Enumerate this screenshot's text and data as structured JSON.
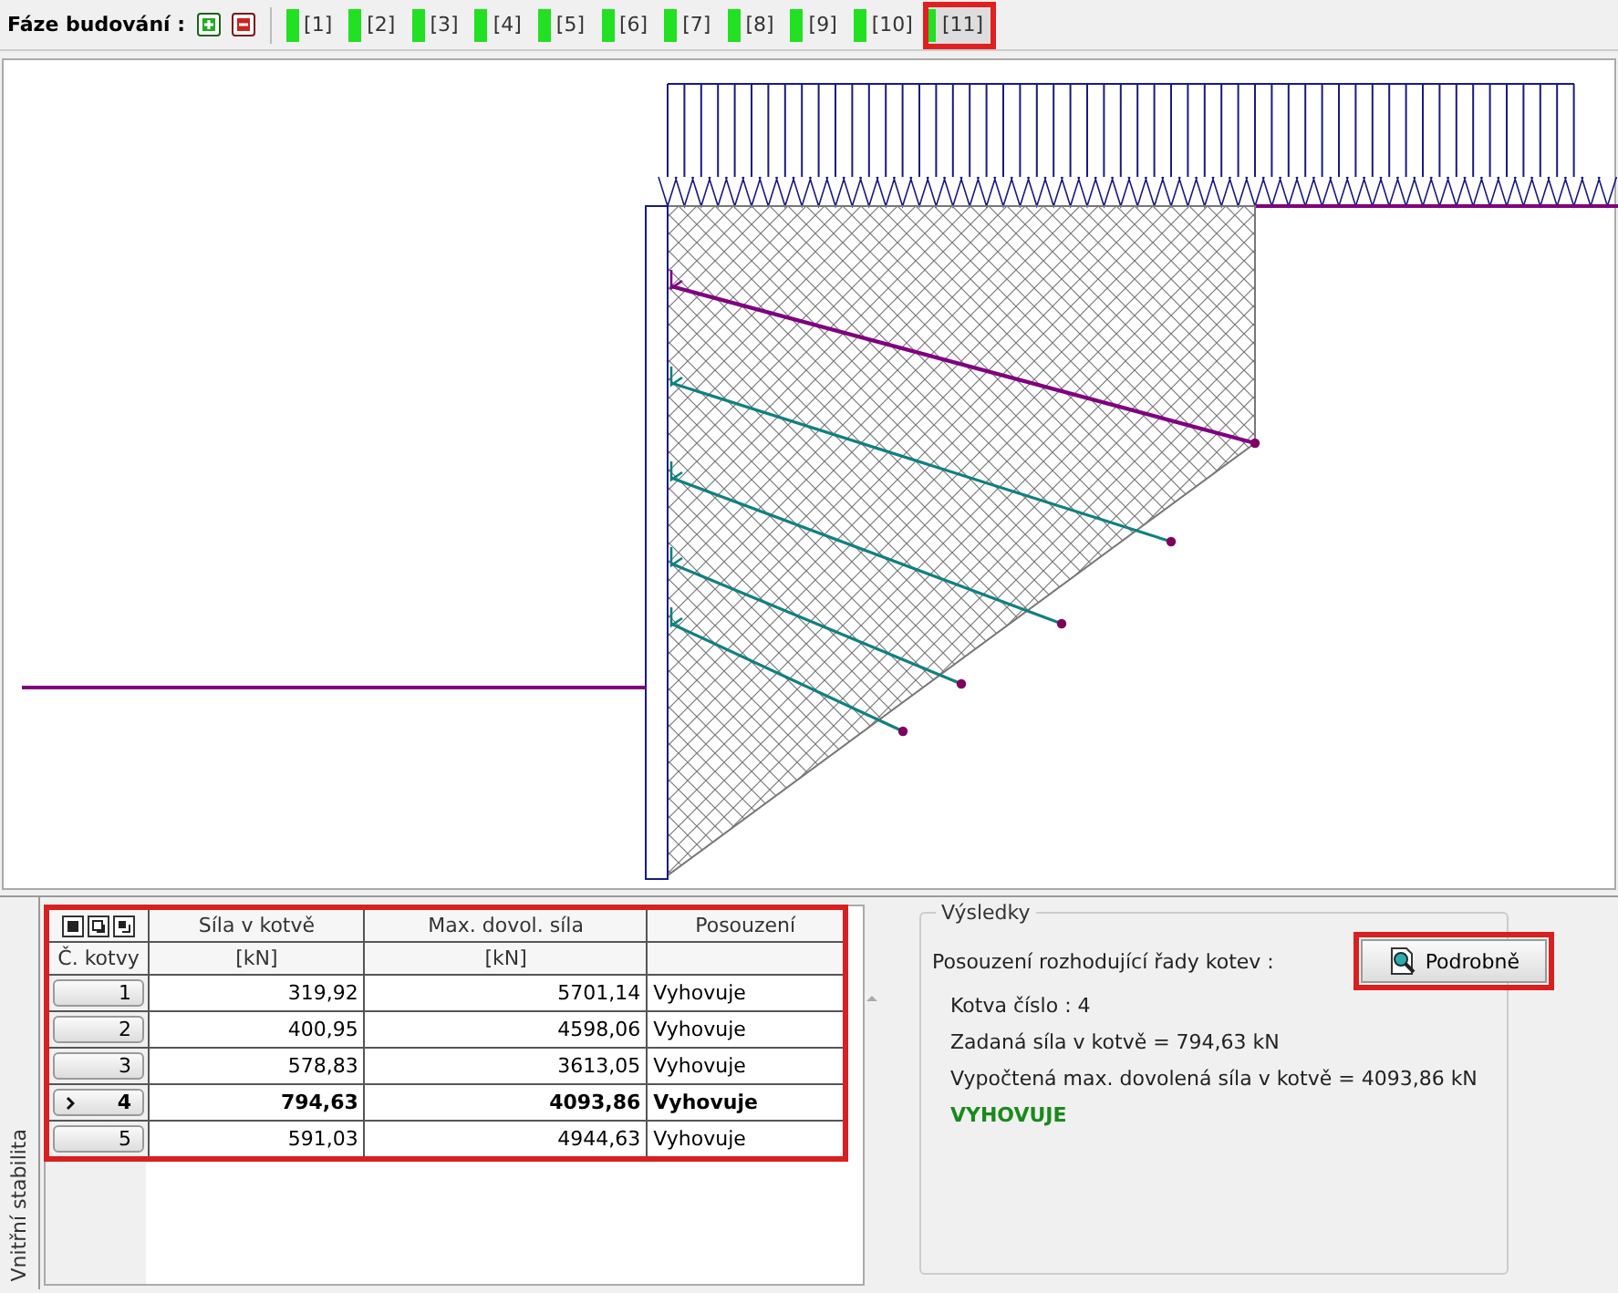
{
  "toolbar": {
    "label": "Fáze budování :",
    "phases": [
      {
        "label": "[1]",
        "selected": false
      },
      {
        "label": "[2]",
        "selected": false
      },
      {
        "label": "[3]",
        "selected": false
      },
      {
        "label": "[4]",
        "selected": false
      },
      {
        "label": "[5]",
        "selected": false
      },
      {
        "label": "[6]",
        "selected": false
      },
      {
        "label": "[7]",
        "selected": false
      },
      {
        "label": "[8]",
        "selected": false
      },
      {
        "label": "[9]",
        "selected": false
      },
      {
        "label": "[10]",
        "selected": false
      },
      {
        "label": "[11]",
        "selected": true
      }
    ]
  },
  "side_tab": "Vnitřní stabilita",
  "table": {
    "columns": [
      {
        "title": "Č. kotvy"
      },
      {
        "title": "Síla v kotvě",
        "unit": "[kN]"
      },
      {
        "title": "Max. dovol. síla",
        "unit": "[kN]"
      },
      {
        "title": "Posouzení"
      }
    ],
    "rows": [
      {
        "number": "1",
        "force": "319,92",
        "max_force": "5701,14",
        "verdict": "Vyhovuje",
        "selected": false
      },
      {
        "number": "2",
        "force": "400,95",
        "max_force": "4598,06",
        "verdict": "Vyhovuje",
        "selected": false
      },
      {
        "number": "3",
        "force": "578,83",
        "max_force": "3613,05",
        "verdict": "Vyhovuje",
        "selected": false
      },
      {
        "number": "4",
        "force": "794,63",
        "max_force": "4093,86",
        "verdict": "Vyhovuje",
        "selected": true
      },
      {
        "number": "5",
        "force": "591,03",
        "max_force": "4944,63",
        "verdict": "Vyhovuje",
        "selected": false
      }
    ]
  },
  "results": {
    "title": "Výsledky",
    "heading": "Posouzení rozhodující řady kotev :",
    "lines": [
      "Kotva číslo : 4",
      "Zadaná síla v kotvě = 794,63 kN",
      "Vypočtená max. dovolená síla v kotvě = 4093,86 kN"
    ],
    "verdict": "VYHOVUJE",
    "button": "Podrobně"
  }
}
